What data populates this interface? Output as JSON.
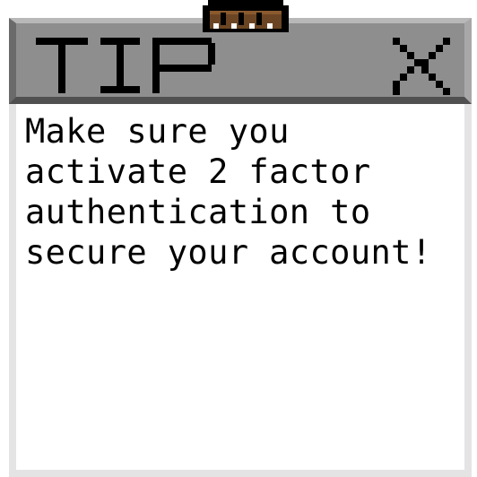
{
  "popup": {
    "title": "TIP",
    "message": "Make sure you\nactivate 2 factor\nauthentication to\nsecure your account!",
    "close_icon": "close-icon",
    "clip_icon": "binder-clip-icon"
  },
  "colors": {
    "titlebar_bg": "#8e8e8e",
    "window_frame": "#e4e4e4",
    "content_bg": "#ffffff",
    "text": "#000000",
    "clip": "#6b4523"
  }
}
